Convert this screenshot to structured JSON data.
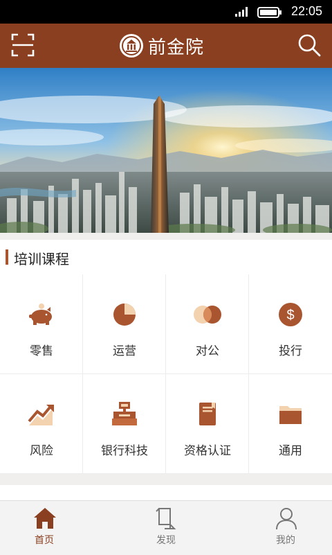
{
  "status_bar": {
    "time": "22:05"
  },
  "header": {
    "title": "前金院"
  },
  "banner": {
    "dots": 2,
    "active_dot": 0
  },
  "training": {
    "section_title": "培训课程",
    "items": [
      {
        "label": "零售",
        "icon": "piggy-bank-icon"
      },
      {
        "label": "运营",
        "icon": "pie-chart-icon"
      },
      {
        "label": "对公",
        "icon": "two-circles-icon"
      },
      {
        "label": "投行",
        "icon": "dollar-coin-icon"
      },
      {
        "label": "风险",
        "icon": "rising-chart-icon"
      },
      {
        "label": "银行科技",
        "icon": "cash-register-icon"
      },
      {
        "label": "资格认证",
        "icon": "certificate-icon"
      },
      {
        "label": "通用",
        "icon": "folder-icon"
      }
    ]
  },
  "tabs": [
    {
      "label": "首页",
      "icon": "home-icon",
      "active": true
    },
    {
      "label": "发现",
      "icon": "discover-icon",
      "active": false
    },
    {
      "label": "我的",
      "icon": "profile-icon",
      "active": false
    }
  ],
  "colors": {
    "brand": "#8a4020",
    "accent": "#a85530",
    "icon_light": "#f3d2b0"
  }
}
